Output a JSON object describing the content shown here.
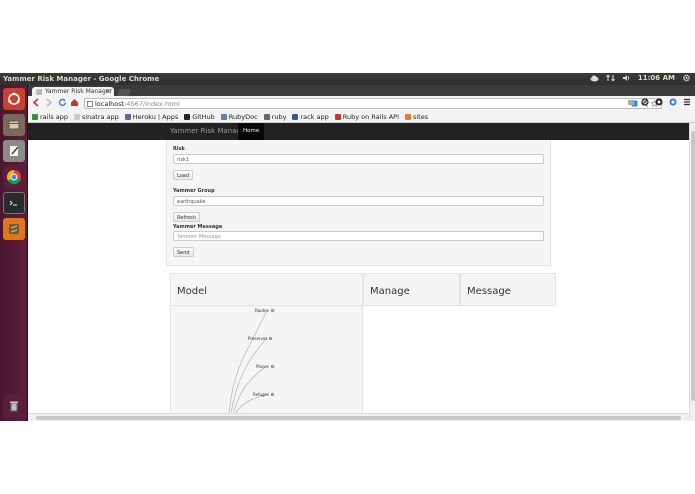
{
  "os": {
    "window_title": "Yammer Risk Manager - Google Chrome",
    "clock": "11:06 AM"
  },
  "chrome": {
    "tab_title": "Yammer Risk Manager",
    "tab_close": "×",
    "url_host": "localhost",
    "url_rest": ":4567/index.html",
    "bookmarks": [
      {
        "label": "rails app",
        "color": "#3a8d3a"
      },
      {
        "label": "sinatra app",
        "color": "#cccccc"
      },
      {
        "label": "Heroku | Apps",
        "color": "#6762a6"
      },
      {
        "label": "GitHub",
        "color": "#222222"
      },
      {
        "label": "RubyDoc",
        "color": "#5a7fb5"
      },
      {
        "label": "ruby",
        "color": "#666666"
      },
      {
        "label": "rack app",
        "color": "#3b5998"
      },
      {
        "label": "Ruby on Rails API",
        "color": "#c0392b"
      },
      {
        "label": "sites",
        "color": "#e67e22"
      }
    ]
  },
  "app": {
    "brand": "Yammer Risk Manager",
    "nav_home": "Home",
    "form": {
      "risk_label": "Risk",
      "risk_value": "risk1",
      "load_button": "Load",
      "group_label": "Yammer Group",
      "group_value": "earthquake",
      "refresh_button": "Refresh",
      "message_label": "Yammer Message",
      "message_placeholder": "Yammer Message",
      "send_button": "Send"
    },
    "panels": {
      "model": "Model",
      "manage": "Manage",
      "message": "Message"
    },
    "tree_nodes": [
      "Routes",
      "Preserves",
      "Places",
      "Refuges"
    ]
  }
}
